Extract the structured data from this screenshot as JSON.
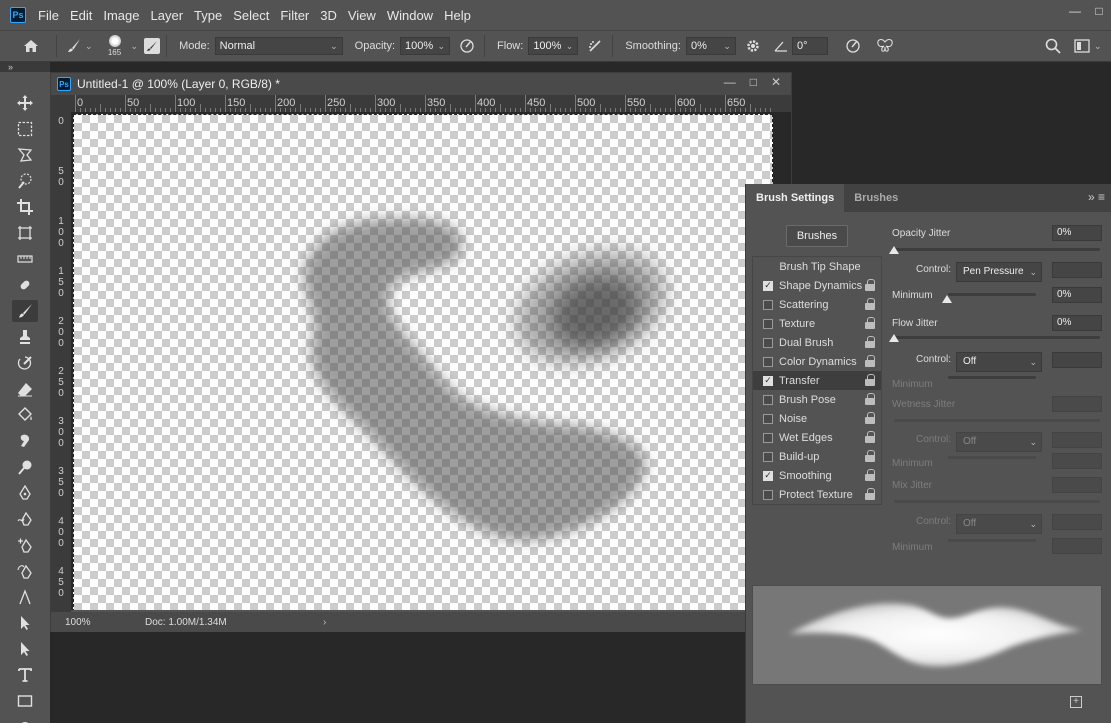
{
  "menu": {
    "logo": "Ps",
    "items": [
      "File",
      "Edit",
      "Image",
      "Layer",
      "Type",
      "Select",
      "Filter",
      "3D",
      "View",
      "Window",
      "Help"
    ]
  },
  "window_controls": {
    "minimize": "—",
    "maximize": "□"
  },
  "options": {
    "brush_size": "165",
    "mode_label": "Mode:",
    "mode_value": "Normal",
    "opacity_label": "Opacity:",
    "opacity_value": "100%",
    "flow_label": "Flow:",
    "flow_value": "100%",
    "smoothing_label": "Smoothing:",
    "smoothing_value": "0%",
    "angle_value": "0°"
  },
  "strip": {
    "label": "»"
  },
  "document": {
    "logo": "Ps",
    "title": "Untitled-1 @ 100% (Layer 0, RGB/8) *",
    "ruler_h": [
      "0",
      "50",
      "100",
      "150",
      "200",
      "250",
      "300",
      "350",
      "400",
      "450",
      "500",
      "550",
      "600",
      "650"
    ],
    "ruler_v": [
      "0",
      "5 0",
      "1 0 0",
      "1 5 0",
      "2 0 0",
      "2 5 0",
      "3 0 0",
      "3 5 0",
      "4 0 0",
      "4 5 0"
    ],
    "zoom": "100%",
    "doc_info": "Doc: 1.00M/1.34M",
    "status_arrow": "›",
    "minimize": "—",
    "maximize": "□",
    "close": "✕"
  },
  "panel": {
    "tabs": [
      "Brush Settings",
      "Brushes"
    ],
    "menu_icon": "»  ≡",
    "brushes_button": "Brushes",
    "list_header": "Brush Tip Shape",
    "items": [
      {
        "label": "Shape Dynamics",
        "checked": true
      },
      {
        "label": "Scattering",
        "checked": false
      },
      {
        "label": "Texture",
        "checked": false
      },
      {
        "label": "Dual Brush",
        "checked": false
      },
      {
        "label": "Color Dynamics",
        "checked": false
      },
      {
        "label": "Transfer",
        "checked": true,
        "selected": true
      },
      {
        "label": "Brush Pose",
        "checked": false
      },
      {
        "label": "Noise",
        "checked": false
      },
      {
        "label": "Wet Edges",
        "checked": false
      },
      {
        "label": "Build-up",
        "checked": false
      },
      {
        "label": "Smoothing",
        "checked": true
      },
      {
        "label": "Protect Texture",
        "checked": false
      }
    ],
    "opacity_jitter_label": "Opacity Jitter",
    "opacity_jitter_value": "0%",
    "control_label": "Control:",
    "control1_value": "Pen Pressure",
    "minimum_label": "Minimum",
    "minimum1_value": "0%",
    "flow_jitter_label": "Flow Jitter",
    "flow_jitter_value": "0%",
    "control2_value": "Off",
    "wetness_jitter_label": "Wetness Jitter",
    "control3_value": "Off",
    "mix_jitter_label": "Mix Jitter",
    "control4_value": "Off",
    "new_icon": "+"
  },
  "colors": {
    "ui_bg": "#535353",
    "workspace": "#282828",
    "panel_tab": "#424242"
  }
}
